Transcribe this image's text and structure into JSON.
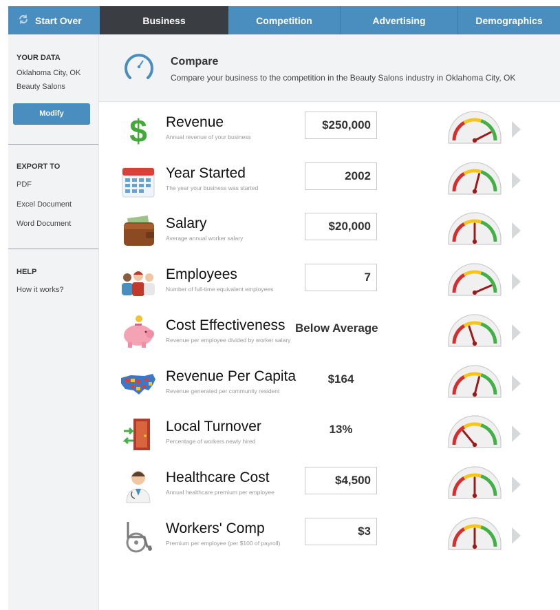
{
  "nav": {
    "start_over": "Start Over",
    "tabs": [
      "Business",
      "Competition",
      "Advertising",
      "Demographics"
    ],
    "active_tab": "Business"
  },
  "sidebar": {
    "your_data_title": "YOUR DATA",
    "location": "Oklahoma City, OK",
    "industry": "Beauty Salons",
    "modify_label": "Modify",
    "export_title": "EXPORT TO",
    "exports": [
      "PDF",
      "Excel Document",
      "Word Document"
    ],
    "help_title": "HELP",
    "help_link": "How it works?"
  },
  "header": {
    "title": "Compare",
    "subtitle": "Compare your business to the competition in the Beauty Salons industry in Oklahoma City, OK"
  },
  "colors": {
    "accent": "#4a8dbf",
    "dark_tab": "#3a3d42",
    "gauge_red": "#d32f2f",
    "gauge_yellow": "#f5c518",
    "gauge_green": "#43b047",
    "needle": "#9b1b1b"
  },
  "metrics": [
    {
      "label": "Revenue",
      "desc": "Annual revenue of your business",
      "value": "$250,000",
      "input": true,
      "icon": "dollar-sign-icon",
      "gauge_level": 0.85
    },
    {
      "label": "Year Started",
      "desc": "The year your business was started",
      "value": "2002",
      "input": true,
      "icon": "calendar-icon",
      "gauge_level": 0.58
    },
    {
      "label": "Salary",
      "desc": "Average annual worker salary",
      "value": "$20,000",
      "input": true,
      "icon": "wallet-icon",
      "gauge_level": 0.5
    },
    {
      "label": "Employees",
      "desc": "Number of full-time equivalent employees",
      "value": "7",
      "input": true,
      "icon": "people-icon",
      "gauge_level": 0.87
    },
    {
      "label": "Cost Effectiveness",
      "desc": "Revenue per employee divided by worker salary",
      "value": "Below Average",
      "input": false,
      "icon": "piggy-bank-icon",
      "gauge_level": 0.4
    },
    {
      "label": "Revenue Per Capita",
      "desc": "Revenue generated per community resident",
      "value": "$164",
      "input": false,
      "icon": "us-map-icon",
      "gauge_level": 0.58
    },
    {
      "label": "Local Turnover",
      "desc": "Percentage of workers newly hired",
      "value": "13%",
      "input": false,
      "icon": "door-exit-icon",
      "gauge_level": 0.28
    },
    {
      "label": "Healthcare Cost",
      "desc": "Annual healthcare premium per employee",
      "value": "$4,500",
      "input": true,
      "icon": "doctor-icon",
      "gauge_level": 0.5
    },
    {
      "label": "Workers' Comp",
      "desc": "Premium per employee (per $100 of payroll)",
      "value": "$3",
      "input": true,
      "icon": "wheelchair-icon",
      "gauge_level": 0.5
    }
  ]
}
